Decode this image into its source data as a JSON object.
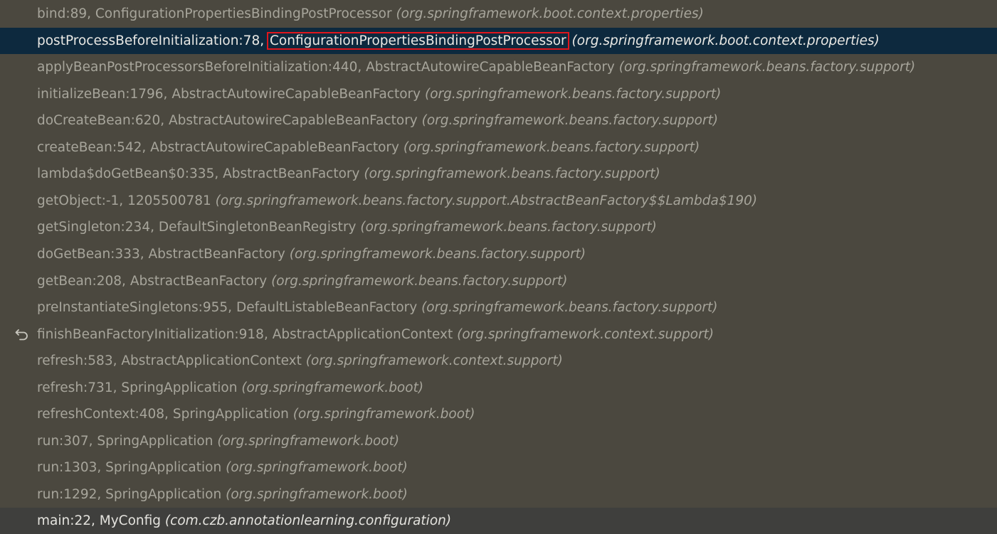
{
  "frames": [
    {
      "method": "bind:89, ",
      "cls": "ConfigurationPropertiesBindingPostProcessor",
      "pkg": " (org.springframework.boot.context.properties)"
    },
    {
      "method": "postProcessBeforeInitialization:78, ",
      "cls": "ConfigurationPropertiesBindingPostProcessor",
      "pkg": " (org.springframework.boot.context.properties)"
    },
    {
      "method": "applyBeanPostProcessorsBeforeInitialization:440, ",
      "cls": "AbstractAutowireCapableBeanFactory",
      "pkg": " (org.springframework.beans.factory.support)"
    },
    {
      "method": "initializeBean:1796, ",
      "cls": "AbstractAutowireCapableBeanFactory",
      "pkg": " (org.springframework.beans.factory.support)"
    },
    {
      "method": "doCreateBean:620, ",
      "cls": "AbstractAutowireCapableBeanFactory",
      "pkg": " (org.springframework.beans.factory.support)"
    },
    {
      "method": "createBean:542, ",
      "cls": "AbstractAutowireCapableBeanFactory",
      "pkg": " (org.springframework.beans.factory.support)"
    },
    {
      "method": "lambda$doGetBean$0:335, ",
      "cls": "AbstractBeanFactory",
      "pkg": " (org.springframework.beans.factory.support)"
    },
    {
      "method": "getObject:-1, ",
      "cls": "1205500781",
      "pkg": " (org.springframework.beans.factory.support.AbstractBeanFactory$$Lambda$190)"
    },
    {
      "method": "getSingleton:234, ",
      "cls": "DefaultSingletonBeanRegistry",
      "pkg": " (org.springframework.beans.factory.support)"
    },
    {
      "method": "doGetBean:333, ",
      "cls": "AbstractBeanFactory",
      "pkg": " (org.springframework.beans.factory.support)"
    },
    {
      "method": "getBean:208, ",
      "cls": "AbstractBeanFactory",
      "pkg": " (org.springframework.beans.factory.support)"
    },
    {
      "method": "preInstantiateSingletons:955, ",
      "cls": "DefaultListableBeanFactory",
      "pkg": " (org.springframework.beans.factory.support)"
    },
    {
      "method": "finishBeanFactoryInitialization:918, ",
      "cls": "AbstractApplicationContext",
      "pkg": " (org.springframework.context.support)"
    },
    {
      "method": "refresh:583, ",
      "cls": "AbstractApplicationContext",
      "pkg": " (org.springframework.context.support)"
    },
    {
      "method": "refresh:731, ",
      "cls": "SpringApplication",
      "pkg": " (org.springframework.boot)"
    },
    {
      "method": "refreshContext:408, ",
      "cls": "SpringApplication",
      "pkg": " (org.springframework.boot)"
    },
    {
      "method": "run:307, ",
      "cls": "SpringApplication",
      "pkg": " (org.springframework.boot)"
    },
    {
      "method": "run:1303, ",
      "cls": "SpringApplication",
      "pkg": " (org.springframework.boot)"
    },
    {
      "method": "run:1292, ",
      "cls": "SpringApplication",
      "pkg": " (org.springframework.boot)"
    },
    {
      "method": "main:22, ",
      "cls": "MyConfig",
      "pkg": " (com.czb.annotationlearning.configuration)"
    }
  ],
  "selected_index": 1,
  "highlighted_index": 1,
  "current_index": 19,
  "drop_frame_index": 12,
  "drop_frame_icon": "undo-arrow-icon",
  "colors": {
    "background": "#4b483f",
    "selected_row": "#0d293e",
    "current_row": "#3f3f3d",
    "text_dim": "#a7a59b",
    "text_bright": "#e9e8e4",
    "highlight_box": "#e0161c"
  }
}
